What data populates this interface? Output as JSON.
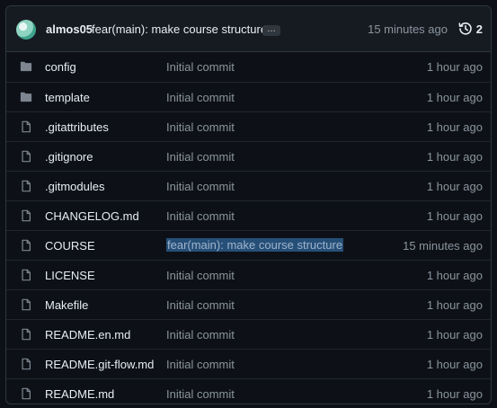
{
  "header": {
    "author": "almos05",
    "commit_message": "fear(main): make course structure",
    "ellipsis": "…",
    "time_ago": "15 minutes ago",
    "history_count": "2"
  },
  "files": [
    {
      "name": "config",
      "type": "folder",
      "message": "Initial commit",
      "time": "1 hour ago"
    },
    {
      "name": "template",
      "type": "folder",
      "message": "Initial commit",
      "time": "1 hour ago"
    },
    {
      "name": ".gitattributes",
      "type": "file",
      "message": "Initial commit",
      "time": "1 hour ago"
    },
    {
      "name": ".gitignore",
      "type": "file",
      "message": "Initial commit",
      "time": "1 hour ago"
    },
    {
      "name": ".gitmodules",
      "type": "file",
      "message": "Initial commit",
      "time": "1 hour ago"
    },
    {
      "name": "CHANGELOG.md",
      "type": "file",
      "message": "Initial commit",
      "time": "1 hour ago"
    },
    {
      "name": "COURSE",
      "type": "file",
      "message": "fear(main): make course structure",
      "time": "15 minutes ago",
      "selected": true
    },
    {
      "name": "LICENSE",
      "type": "file",
      "message": "Initial commit",
      "time": "1 hour ago"
    },
    {
      "name": "Makefile",
      "type": "file",
      "message": "Initial commit",
      "time": "1 hour ago"
    },
    {
      "name": "README.en.md",
      "type": "file",
      "message": "Initial commit",
      "time": "1 hour ago"
    },
    {
      "name": "README.git-flow.md",
      "type": "file",
      "message": "Initial commit",
      "time": "1 hour ago"
    },
    {
      "name": "README.md",
      "type": "file",
      "message": "Initial commit",
      "time": "1 hour ago"
    }
  ],
  "colors": {
    "background": "#0d1117",
    "header_bg": "#161b22",
    "border": "#30363d",
    "text": "#e6edf3",
    "muted": "#8b949e",
    "selection": "#264f78"
  }
}
